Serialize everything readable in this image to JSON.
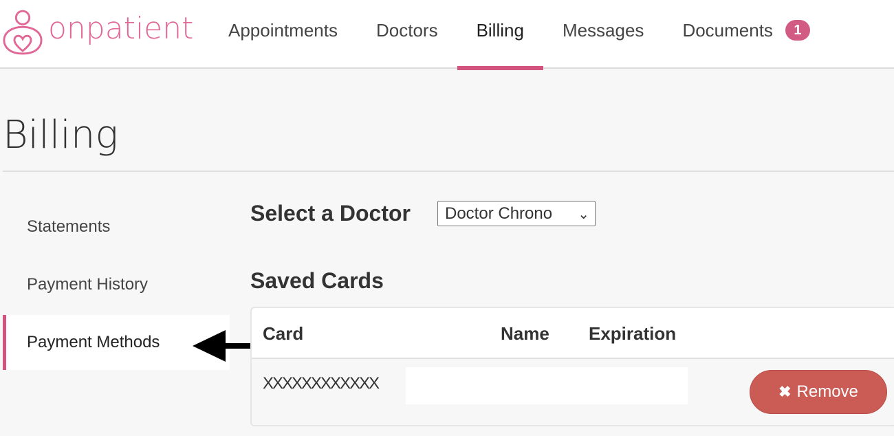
{
  "brand": {
    "name": "onpatient",
    "logo_icon": "person-heart-icon",
    "accent": "#d2547e"
  },
  "nav": {
    "items": [
      {
        "label": "Appointments",
        "active": false
      },
      {
        "label": "Doctors",
        "active": false
      },
      {
        "label": "Billing",
        "active": true
      },
      {
        "label": "Messages",
        "active": false
      },
      {
        "label": "Documents",
        "active": false,
        "badge": "1"
      }
    ]
  },
  "page": {
    "title": "Billing"
  },
  "sidebar": {
    "items": [
      {
        "label": "Statements",
        "active": false
      },
      {
        "label": "Payment History",
        "active": false
      },
      {
        "label": "Payment Methods",
        "active": true
      }
    ]
  },
  "doctor_select": {
    "label": "Select a Doctor",
    "value": "Doctor Chrono"
  },
  "saved_cards": {
    "title": "Saved Cards",
    "columns": [
      "Card",
      "Name",
      "Expiration"
    ],
    "rows": [
      {
        "card": "XXXXXXXXXXXX",
        "name": "",
        "expiration": "",
        "action": "Remove"
      }
    ],
    "remove_color": "#cb5b55"
  },
  "annotation": {
    "arrow_icon": "left-arrow-icon",
    "points_to": "Payment Methods"
  }
}
